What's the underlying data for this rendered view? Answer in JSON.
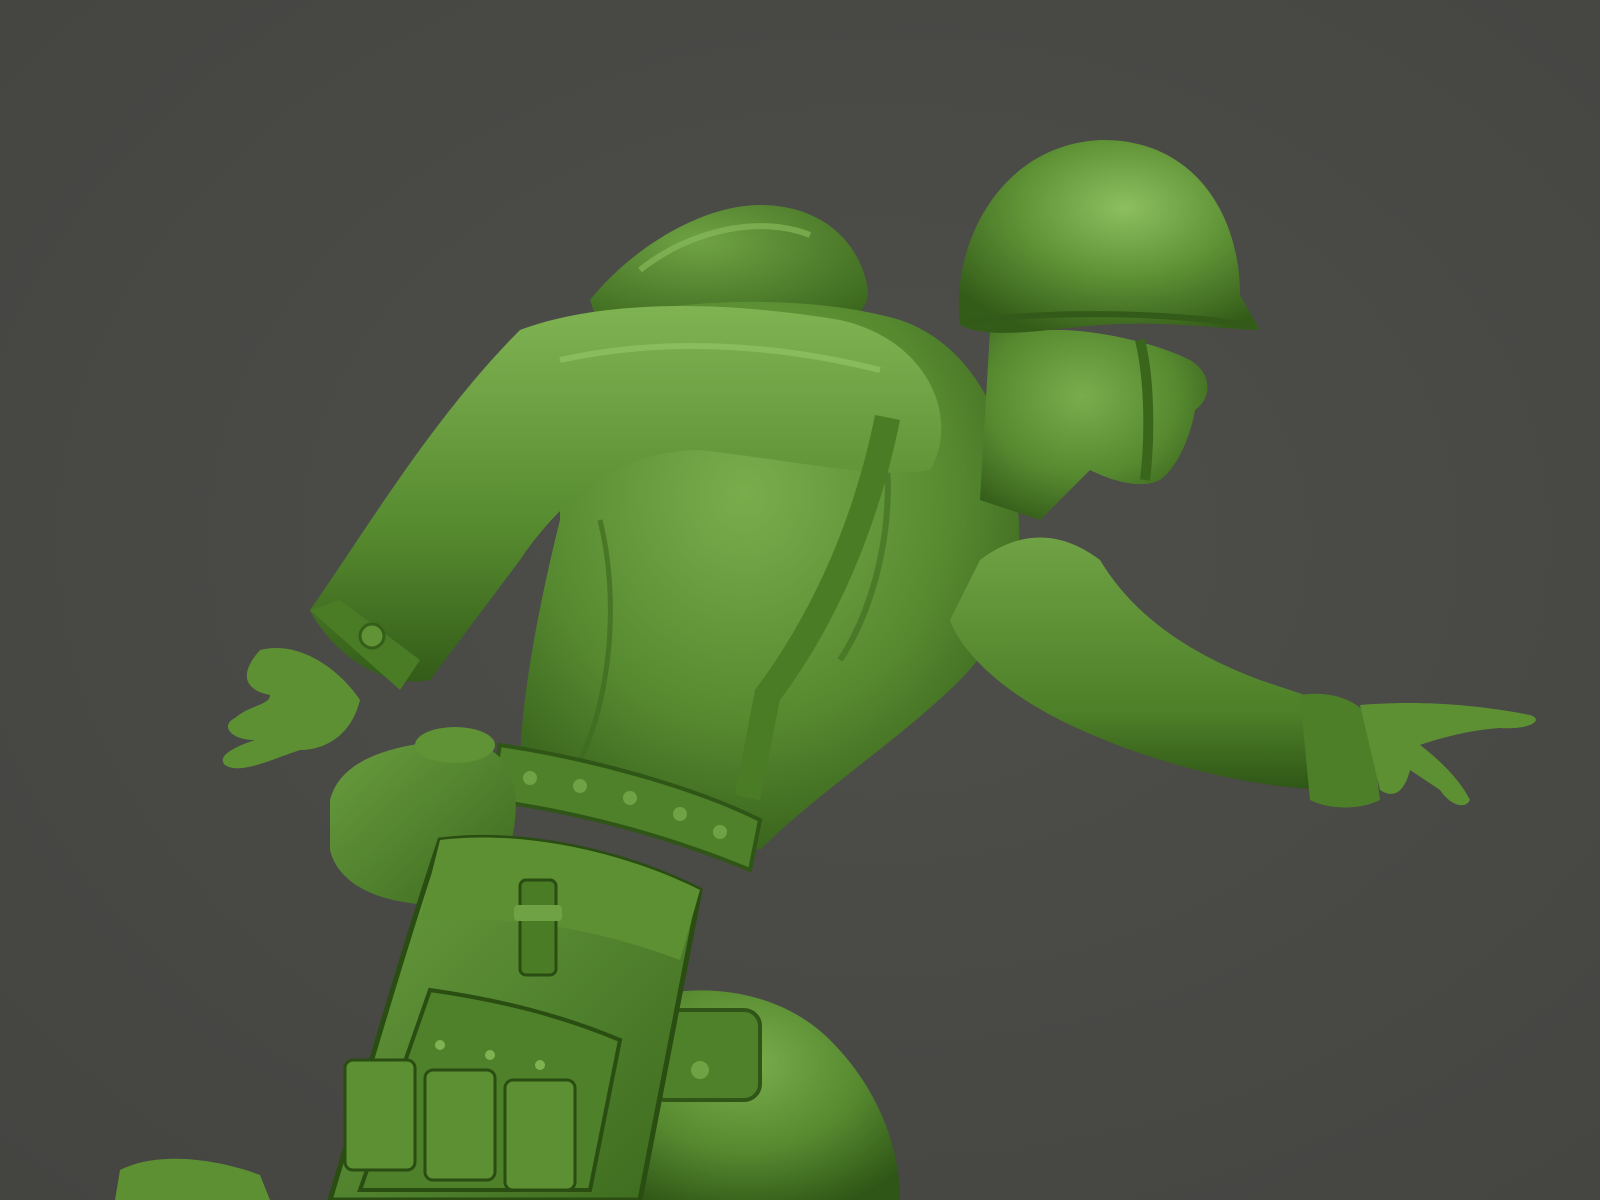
{
  "scene": {
    "subject": "toy-soldier-sculpt",
    "colors": {
      "background": "#4a4a47",
      "material_base": "#4f7f2c",
      "material_light": "#74a84a",
      "material_highlight": "#8fc063",
      "material_shadow": "#2f5616",
      "material_deep": "#22420f"
    }
  }
}
